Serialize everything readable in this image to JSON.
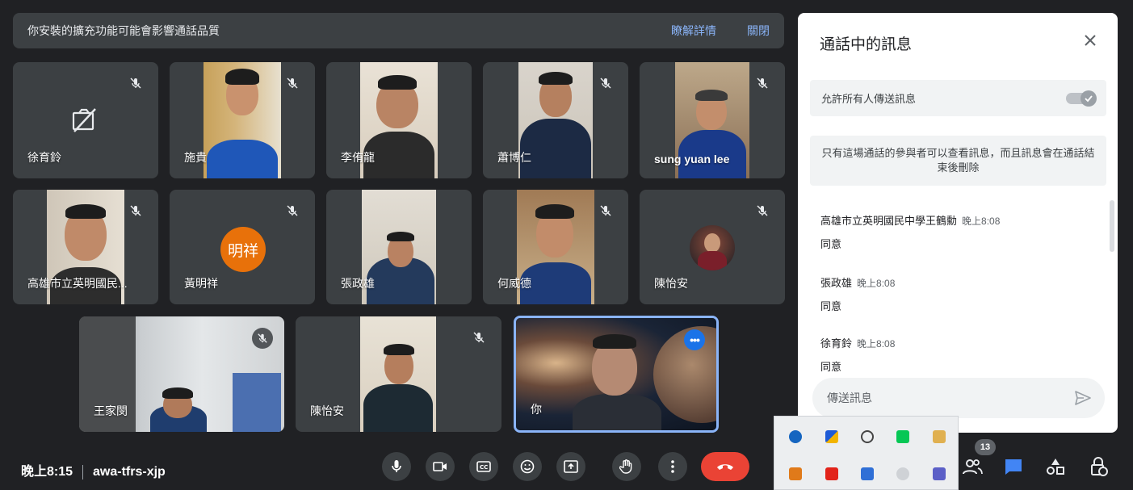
{
  "banner": {
    "message": "你安裝的擴充功能可能會影響通話品質",
    "details_link": "瞭解詳情",
    "close_link": "關閉"
  },
  "participants": [
    {
      "name": "徐育鈴"
    },
    {
      "name": "施貴"
    },
    {
      "name": "李侑龍"
    },
    {
      "name": "蕭博仁"
    },
    {
      "name": "sung yuan lee"
    },
    {
      "name": "高雄市立英明國民..."
    },
    {
      "name": "黃明祥",
      "avatar_text": "明祥",
      "avatar_color": "#e8710a"
    },
    {
      "name": "張政雄"
    },
    {
      "name": "何威德"
    },
    {
      "name": "陳怡安"
    },
    {
      "name": "王家閔"
    },
    {
      "name": "陳怡安"
    },
    {
      "name": "你"
    }
  ],
  "chat": {
    "title": "通話中的訊息",
    "allow_label": "允許所有人傳送訊息",
    "allow_enabled": true,
    "info": "只有這場通話的參與者可以查看訊息，而且訊息會在通話結束後刪除",
    "messages": [
      {
        "sender": "高雄市立英明國民中學王鶴勳",
        "time": "晚上8:08",
        "text": "同意"
      },
      {
        "sender": "張政雄",
        "time": "晚上8:08",
        "text": "同意"
      },
      {
        "sender": "徐育鈴",
        "time": "晚上8:08",
        "text": "同意"
      }
    ],
    "input_placeholder": "傳送訊息"
  },
  "bottom": {
    "time": "晚上8:15",
    "meeting_code": "awa-tfrs-xjp",
    "people_count": "13"
  },
  "colors": {
    "background": "#202124",
    "tile": "#3c4043",
    "accent_blue": "#8ab4f8",
    "end_call_red": "#ea4335",
    "chat_blue": "#4285f4"
  }
}
